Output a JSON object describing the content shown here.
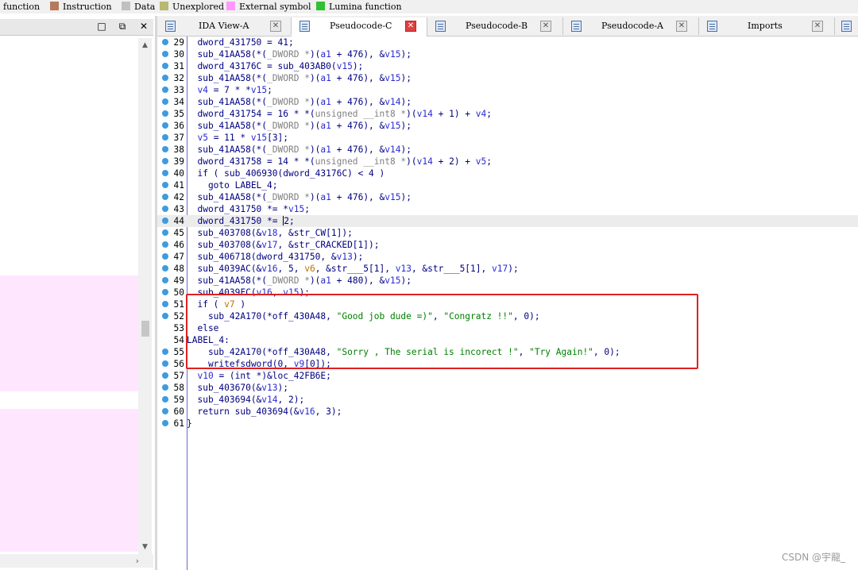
{
  "legend": [
    {
      "label": "function",
      "color": "#f0f0f0"
    },
    {
      "label": "Instruction",
      "color": "#b47a5a"
    },
    {
      "label": "Data",
      "color": "#c0c0c0"
    },
    {
      "label": "Unexplored",
      "color": "#b8b870"
    },
    {
      "label": "External symbol",
      "color": "#ff99ff"
    },
    {
      "label": "Lumina function",
      "color": "#30c030"
    }
  ],
  "tabs": [
    {
      "label": "IDA View-A"
    },
    {
      "label": "Pseudocode-C"
    },
    {
      "label": "Pseudocode-B"
    },
    {
      "label": "Pseudocode-A"
    },
    {
      "label": "Imports"
    }
  ],
  "code": [
    {
      "n": "29",
      "dot": true
    },
    {
      "n": "30",
      "dot": true
    },
    {
      "n": "31",
      "dot": true
    },
    {
      "n": "32",
      "dot": true
    },
    {
      "n": "33",
      "dot": true
    },
    {
      "n": "34",
      "dot": true
    },
    {
      "n": "35",
      "dot": true
    },
    {
      "n": "36",
      "dot": true
    },
    {
      "n": "37",
      "dot": true
    },
    {
      "n": "38",
      "dot": true
    },
    {
      "n": "39",
      "dot": true
    },
    {
      "n": "40",
      "dot": true
    },
    {
      "n": "41",
      "dot": true
    },
    {
      "n": "42",
      "dot": true
    },
    {
      "n": "43",
      "dot": true
    },
    {
      "n": "44",
      "dot": true
    },
    {
      "n": "45",
      "dot": true
    },
    {
      "n": "46",
      "dot": true
    },
    {
      "n": "47",
      "dot": true
    },
    {
      "n": "48",
      "dot": true
    },
    {
      "n": "49",
      "dot": true
    },
    {
      "n": "50",
      "dot": true
    },
    {
      "n": "51",
      "dot": true
    },
    {
      "n": "52",
      "dot": true
    },
    {
      "n": "53",
      "dot": false
    },
    {
      "n": "54",
      "dot": false
    },
    {
      "n": "55",
      "dot": true
    },
    {
      "n": "56",
      "dot": true
    },
    {
      "n": "57",
      "dot": true
    },
    {
      "n": "58",
      "dot": true
    },
    {
      "n": "59",
      "dot": true
    },
    {
      "n": "60",
      "dot": true
    },
    {
      "n": "61",
      "dot": true
    }
  ],
  "watermark": "CSDN @宇龍_"
}
